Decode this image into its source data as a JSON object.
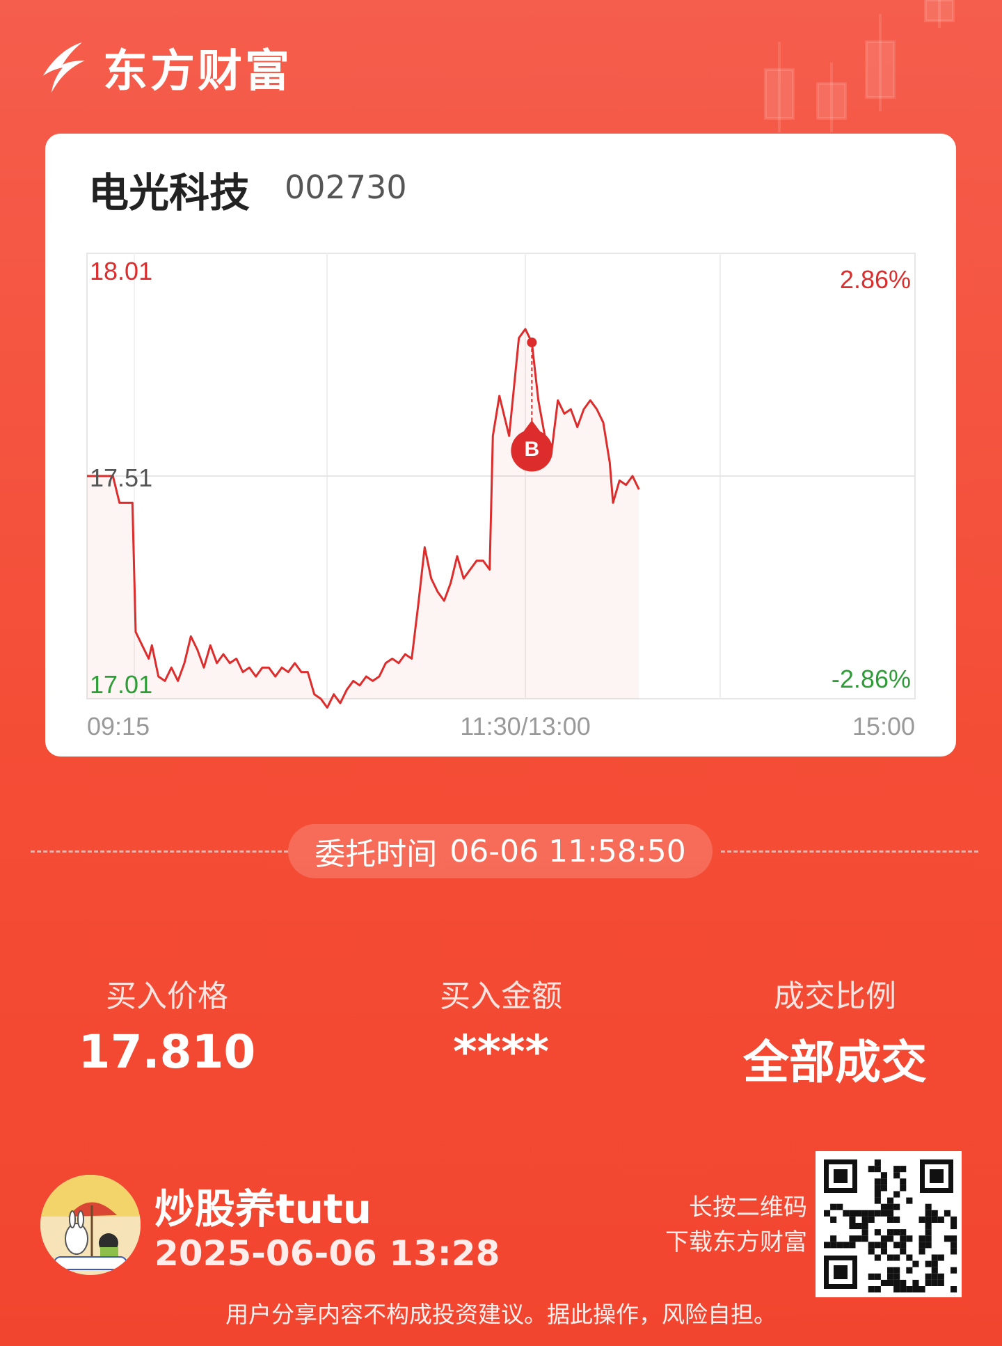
{
  "brand": {
    "name": "东方财富"
  },
  "stock": {
    "name": "电光科技",
    "code": "002730"
  },
  "chart_data": {
    "type": "line",
    "title": "",
    "x_ticks": [
      "09:15",
      "11:30/13:00",
      "15:00"
    ],
    "y_left_labels": {
      "top": "18.01",
      "mid": "17.51",
      "bottom": "17.01"
    },
    "y_right_labels": {
      "top": "2.86%",
      "bottom": "-2.86%"
    },
    "ylim": [
      17.01,
      18.01
    ],
    "prev_close": 17.51,
    "x_unit": "minutes since 09:15 (session time, 0=09:15, 135=11:30/13:00, 255=15:00)",
    "series": [
      {
        "values": [
          [
            0,
            17.51
          ],
          [
            8,
            17.51
          ],
          [
            10,
            17.45
          ],
          [
            14,
            17.45
          ],
          [
            15,
            17.16
          ],
          [
            17,
            17.13
          ],
          [
            19,
            17.1
          ],
          [
            20,
            17.13
          ],
          [
            22,
            17.06
          ],
          [
            24,
            17.05
          ],
          [
            26,
            17.08
          ],
          [
            28,
            17.05
          ],
          [
            30,
            17.09
          ],
          [
            32,
            17.15
          ],
          [
            34,
            17.12
          ],
          [
            36,
            17.08
          ],
          [
            38,
            17.13
          ],
          [
            40,
            17.09
          ],
          [
            42,
            17.11
          ],
          [
            44,
            17.09
          ],
          [
            46,
            17.1
          ],
          [
            48,
            17.07
          ],
          [
            50,
            17.08
          ],
          [
            52,
            17.06
          ],
          [
            54,
            17.08
          ],
          [
            56,
            17.08
          ],
          [
            58,
            17.06
          ],
          [
            60,
            17.08
          ],
          [
            62,
            17.07
          ],
          [
            64,
            17.09
          ],
          [
            66,
            17.07
          ],
          [
            68,
            17.07
          ],
          [
            70,
            17.02
          ],
          [
            72,
            17.01
          ],
          [
            74,
            16.99
          ],
          [
            76,
            17.02
          ],
          [
            78,
            17.0
          ],
          [
            80,
            17.03
          ],
          [
            82,
            17.05
          ],
          [
            84,
            17.04
          ],
          [
            86,
            17.06
          ],
          [
            88,
            17.05
          ],
          [
            90,
            17.06
          ],
          [
            92,
            17.09
          ],
          [
            94,
            17.1
          ],
          [
            96,
            17.09
          ],
          [
            98,
            17.11
          ],
          [
            100,
            17.1
          ],
          [
            102,
            17.22
          ],
          [
            104,
            17.35
          ],
          [
            106,
            17.28
          ],
          [
            108,
            17.25
          ],
          [
            110,
            17.23
          ],
          [
            112,
            17.27
          ],
          [
            114,
            17.33
          ],
          [
            116,
            17.28
          ],
          [
            118,
            17.3
          ],
          [
            120,
            17.32
          ],
          [
            122,
            17.32
          ],
          [
            124,
            17.3
          ],
          [
            125,
            17.6
          ],
          [
            127,
            17.69
          ],
          [
            130,
            17.6
          ],
          [
            133,
            17.82
          ],
          [
            135,
            17.84
          ],
          [
            137,
            17.81
          ],
          [
            139,
            17.68
          ],
          [
            141,
            17.6
          ],
          [
            143,
            17.56
          ],
          [
            145,
            17.68
          ],
          [
            147,
            17.65
          ],
          [
            149,
            17.66
          ],
          [
            151,
            17.62
          ],
          [
            153,
            17.66
          ],
          [
            155,
            17.68
          ],
          [
            157,
            17.66
          ],
          [
            159,
            17.63
          ],
          [
            161,
            17.54
          ],
          [
            162,
            17.45
          ],
          [
            164,
            17.5
          ],
          [
            166,
            17.49
          ],
          [
            168,
            17.51
          ],
          [
            170,
            17.48
          ]
        ]
      }
    ],
    "marker": {
      "label": "B",
      "price": 17.81
    }
  },
  "order": {
    "label": "委托时间",
    "time": "06-06 11:58:50"
  },
  "stats": {
    "price_label": "买入价格",
    "price_value": "17.810",
    "amount_label": "买入金额",
    "amount_value": "****",
    "ratio_label": "成交比例",
    "ratio_value": "全部成交"
  },
  "user": {
    "name": "炒股养tutu",
    "share_time": "2025-06-06 13:28"
  },
  "qr_hint": {
    "line1": "长按二维码",
    "line2": "下载东方财富"
  },
  "disclaimer": "用户分享内容不构成投资建议。据此操作，风险自担。",
  "colors": {
    "up": "#dd2c2c",
    "down": "#2e9d38",
    "accent": "#f44d36"
  }
}
